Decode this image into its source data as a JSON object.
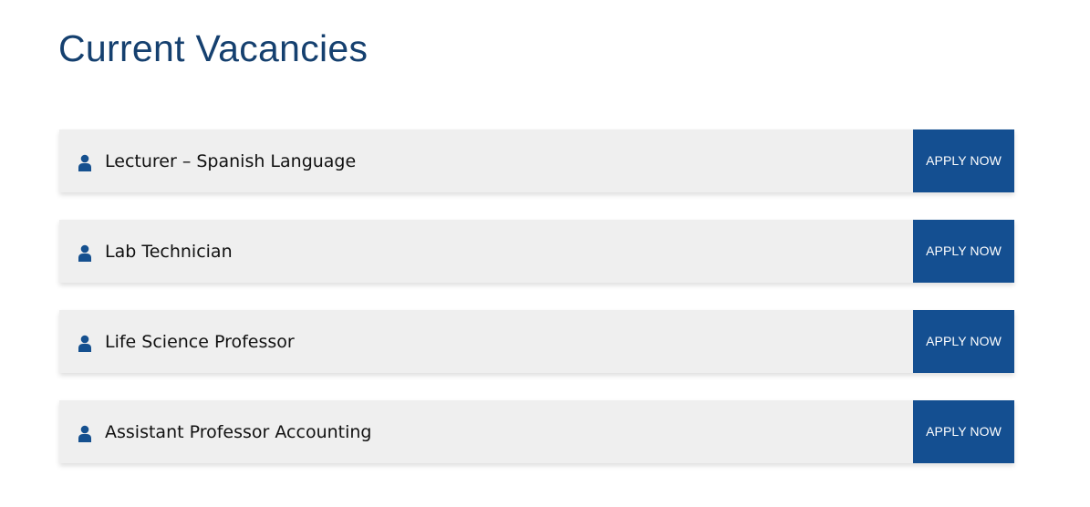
{
  "page": {
    "title": "Current Vacancies"
  },
  "colors": {
    "title": "#15406f",
    "row_background": "#efefef",
    "button_background": "#144f91",
    "button_text": "#ffffff",
    "icon": "#15508f"
  },
  "icons": {
    "row_icon": "user-icon"
  },
  "vacancies": [
    {
      "title": "Lecturer – Spanish Language",
      "button_label": "APPLY NOW"
    },
    {
      "title": "Lab Technician",
      "button_label": "APPLY NOW"
    },
    {
      "title": "Life Science Professor",
      "button_label": "APPLY NOW"
    },
    {
      "title": "Assistant Professor Accounting",
      "button_label": "APPLY NOW"
    }
  ]
}
